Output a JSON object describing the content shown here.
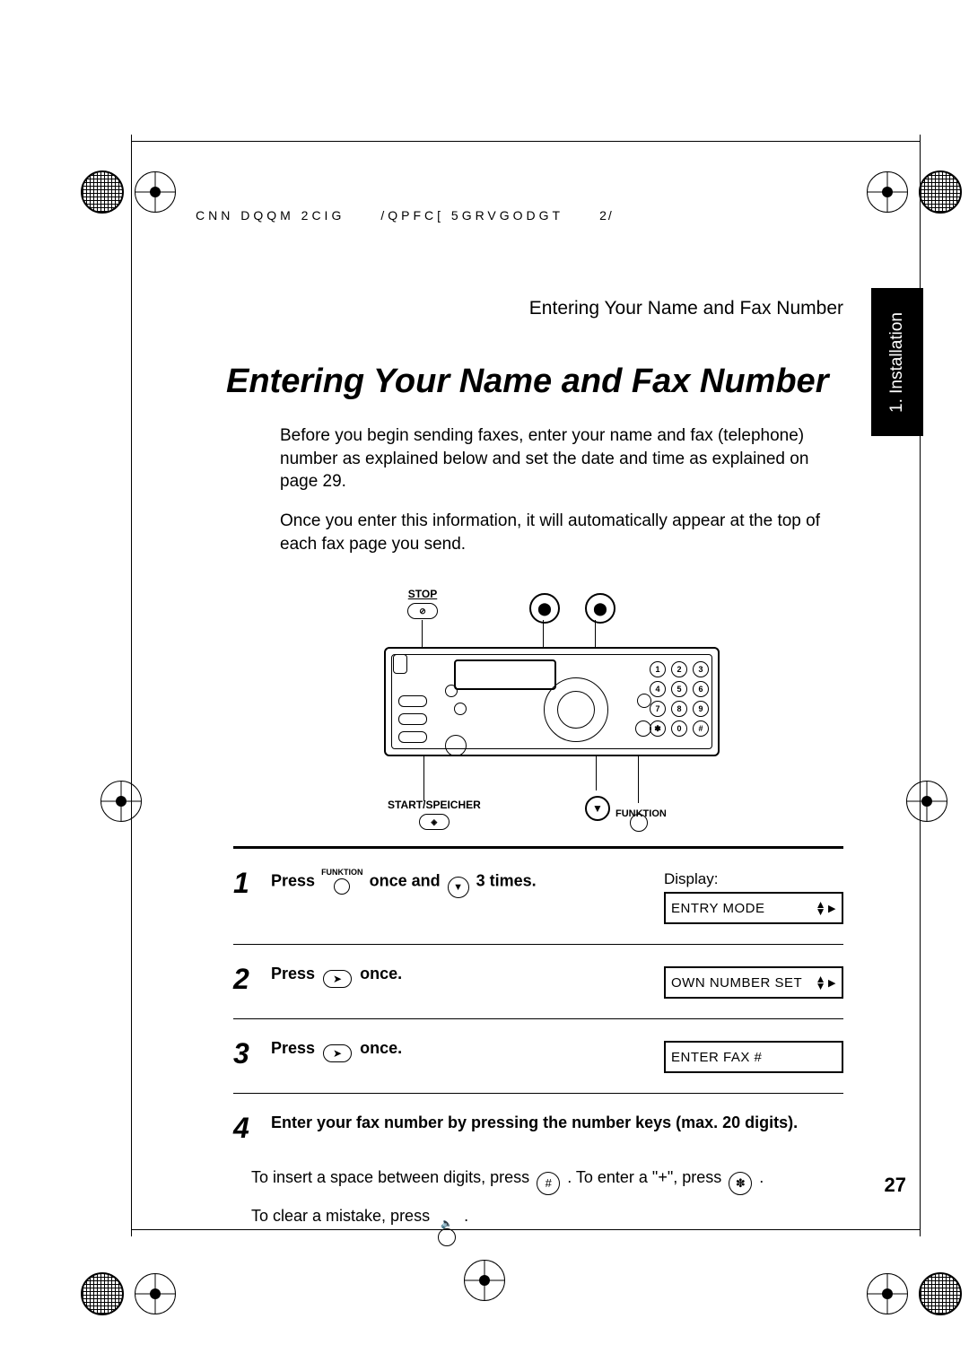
{
  "header": {
    "code": "CNN DQQM 2CIG",
    "file": "/QPFC[ 5GRVGODGT",
    "extra": "2/"
  },
  "sideTab": "1. Installation",
  "runningHead": "Entering Your Name and Fax Number",
  "title": "Entering Your Name and Fax Number",
  "para1": "Before you begin sending faxes, enter your name and fax (telephone) number as explained below and set the date and time as explained on page 29.",
  "para2": "Once you enter this information, it will automatically appear at the top of each fax page you send.",
  "figure": {
    "stopLabel": "STOP",
    "startLabel": "START/SPEICHER",
    "funkLabel": "FUNKTION",
    "keys": [
      "1",
      "2",
      "3",
      "4",
      "5",
      "6",
      "7",
      "8",
      "9",
      "✽",
      "0",
      "#"
    ]
  },
  "steps": {
    "displayWord": "Display:",
    "s1": {
      "n": "1",
      "a": "Press",
      "funk": "FUNKTION",
      "b": "once and",
      "c": "3 times.",
      "lcd": "ENTRY MODE"
    },
    "s2": {
      "n": "2",
      "a": "Press",
      "b": "once.",
      "lcd": "OWN NUMBER SET"
    },
    "s3": {
      "n": "3",
      "a": "Press",
      "b": "once.",
      "lcd": "ENTER FAX #"
    },
    "s4": {
      "n": "4",
      "head": "Enter your fax number by pressing the number keys (max. 20 digits).",
      "l1a": "To insert a space between digits, press",
      "l1key1": "#",
      "l1b": ". To enter a \"+\", press",
      "l1key2": "✽",
      "l1c": ".",
      "l2a": "To clear a mistake, press",
      "l2b": "."
    }
  },
  "pageNumber": "27"
}
